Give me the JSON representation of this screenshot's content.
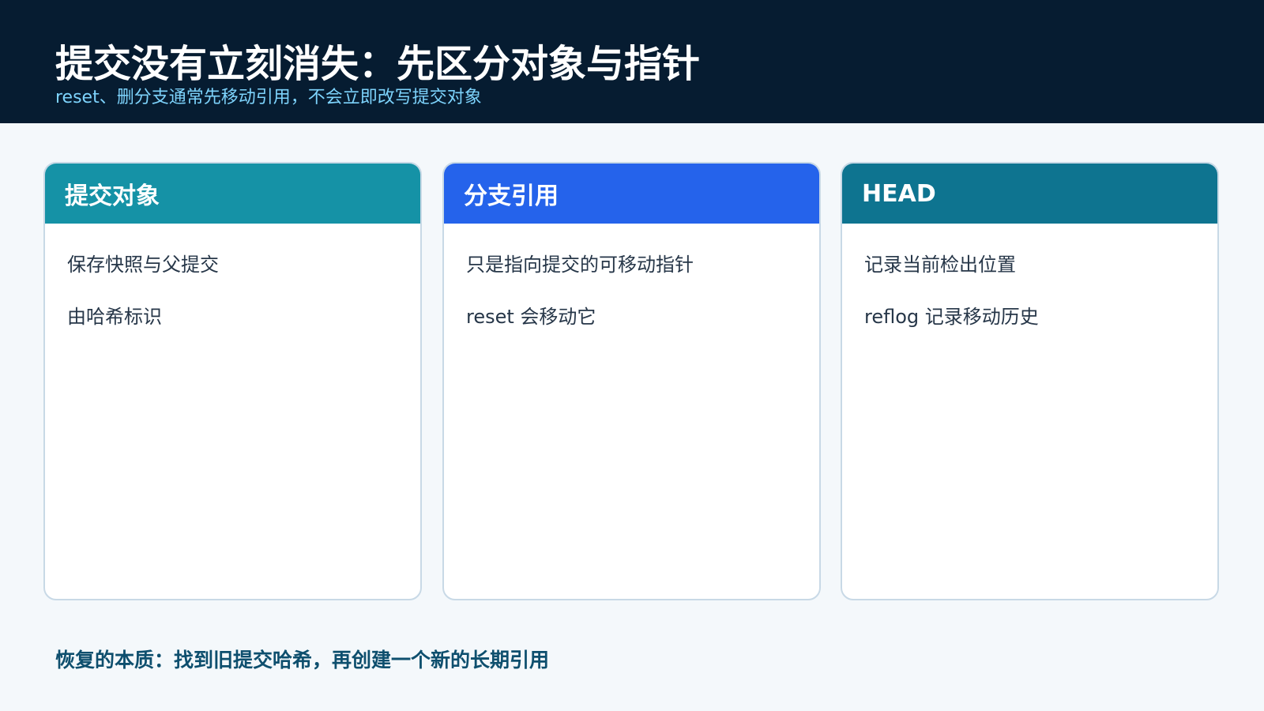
{
  "header": {
    "title": "提交没有立刻消失：先区分对象与指针",
    "subtitle": "reset、删分支通常先移动引用，不会立即改写提交对象"
  },
  "cards": [
    {
      "heading": "提交对象",
      "lines": [
        "保存快照与父提交",
        "由哈希标识"
      ]
    },
    {
      "heading": "分支引用",
      "lines": [
        "只是指向提交的可移动指针",
        "reset 会移动它"
      ]
    },
    {
      "heading": "HEAD",
      "lines": [
        "记录当前检出位置",
        "reflog 记录移动历史"
      ]
    }
  ],
  "footer": {
    "note": "恢复的本质：找到旧提交哈希，再创建一个新的长期引用"
  },
  "colors": {
    "header_bg": "#061c31",
    "subtitle": "#7dd3fc",
    "card1_head": "#1592a6",
    "card2_head": "#2563eb",
    "card3_head": "#0e7490",
    "footer_text": "#0e4f6e"
  }
}
